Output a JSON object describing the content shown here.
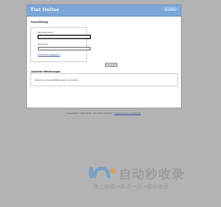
{
  "header": {
    "title": "Tint Online",
    "link": "Anmelden"
  },
  "login": {
    "heading": "Anmeldung",
    "username_label": "Benutzername",
    "password_label": "Kennwort",
    "forgot_link": "Kennwort vergessen?",
    "submit_label": "Anmelden"
  },
  "news": {
    "heading": "Aktuelle Mitteilungen",
    "text": "Aktuell sind keine Mitteilungen vorhanden."
  },
  "footer": {
    "text": "Copyright © 2012-2015 · All rights reserved ·",
    "link": "Datenschutz / Impressum"
  },
  "watermark": {
    "main": "自动秒收录",
    "sub": "做上链接→来访一次→自动收录"
  },
  "colors": {
    "header": "#7aa6d8",
    "background": "#b3b3b6",
    "link": "#2a4f9a"
  }
}
